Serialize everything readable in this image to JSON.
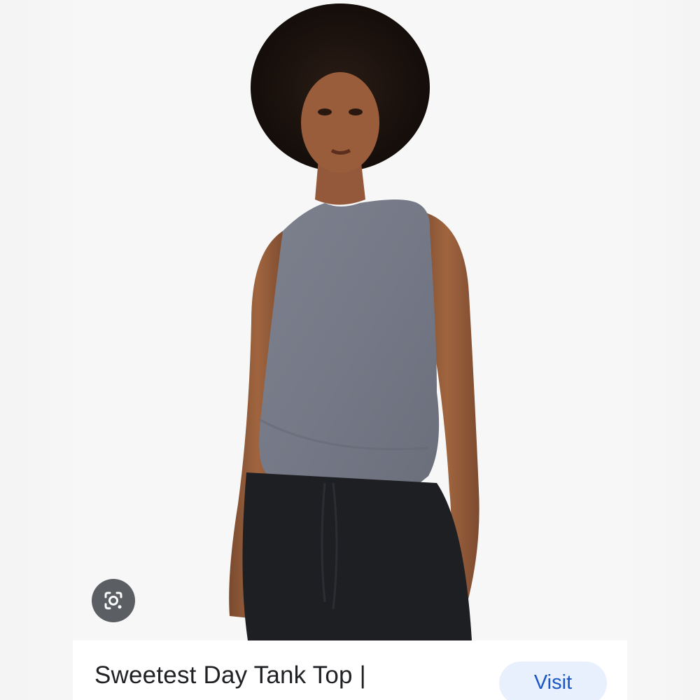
{
  "result": {
    "title": "Sweetest Day Tank Top |",
    "visit_label": "Visit"
  },
  "image": {
    "subject": "model wearing grey tank top and black joggers"
  },
  "icons": {
    "lens": "google-lens-icon"
  },
  "colors": {
    "visit_bg": "#e8f0fe",
    "visit_text": "#1a56c4",
    "lens_bg": "#5b5e63"
  }
}
